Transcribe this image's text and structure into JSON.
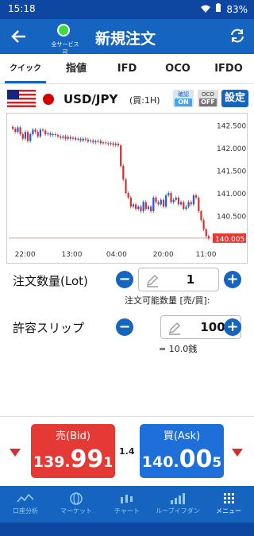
{
  "status": {
    "time": "15:18",
    "battery": "83%"
  },
  "header": {
    "title": "新規注文",
    "service_label": "全サービス可"
  },
  "tabs": [
    {
      "label": "クイック"
    },
    {
      "label": "指値"
    },
    {
      "label": "IFD"
    },
    {
      "label": "OCO"
    },
    {
      "label": "IFDO"
    }
  ],
  "pair": {
    "symbol": "USD/JPY",
    "period": "(買:1H)",
    "confirm_label": "確認",
    "confirm_state": "ON",
    "oco_label": "OCO",
    "oco_state": "OFF",
    "settings_label": "設定"
  },
  "chart_data": {
    "type": "candlestick",
    "x_ticks": [
      "22:00",
      "13:00",
      "04:00",
      "20:00",
      "11:00"
    ],
    "y_ticks": [
      "142.500",
      "142.000",
      "141.500",
      "141.000",
      "140.500"
    ],
    "current_price": "140.005",
    "ylim": [
      139.95,
      142.65
    ],
    "closes": [
      142.42,
      142.35,
      142.45,
      142.3,
      142.2,
      142.35,
      142.15,
      142.3,
      142.4,
      142.35,
      142.25,
      142.4,
      142.38,
      142.3,
      142.32,
      142.28,
      142.3,
      142.28,
      142.25,
      142.22,
      142.25,
      142.2,
      142.24,
      142.2,
      142.22,
      142.18,
      142.2,
      142.16,
      142.2,
      142.18,
      142.14,
      142.16,
      142.12,
      142.14,
      142.15,
      142.1,
      142.12,
      142.1,
      142.08,
      142.1,
      142.06,
      142.09,
      142.05,
      141.6,
      141.3,
      141.0,
      140.9,
      140.7,
      140.75,
      140.65,
      140.7,
      140.6,
      140.8,
      140.65,
      140.7,
      140.6,
      140.9,
      140.8,
      140.75,
      140.85,
      140.7,
      140.95,
      141.0,
      140.8,
      140.85,
      140.9,
      140.75,
      140.8,
      140.65,
      140.7,
      140.8,
      140.75,
      140.95,
      140.9,
      140.6,
      140.4,
      140.2,
      140.05,
      140.0
    ]
  },
  "order": {
    "qty_label": "注文数量(Lot)",
    "qty_value": "1",
    "avail_label": "注文可能数量 [売/買]:",
    "slip_label": "許容スリップ",
    "slip_value": "100",
    "slip_note": "= 10.0銭",
    "minus": "−",
    "plus": "+"
  },
  "prices": {
    "sell_label": "売(Bid)",
    "sell_p1": "139.",
    "sell_p2": "99",
    "sell_p3": "1",
    "buy_label": "買(Ask)",
    "buy_p1": "140.",
    "buy_p2": "00",
    "buy_p3": "5",
    "spread": "1.4"
  },
  "nav": [
    {
      "label": "口座分析"
    },
    {
      "label": "マーケット"
    },
    {
      "label": "チャート"
    },
    {
      "label": "ループイフダン"
    },
    {
      "label": "メニュー"
    }
  ],
  "colors": {
    "primary": "#1565c0",
    "sell": "#e53935",
    "buy": "#1e6fd9",
    "up": "#1e5bd6",
    "down": "#d32f2f"
  }
}
